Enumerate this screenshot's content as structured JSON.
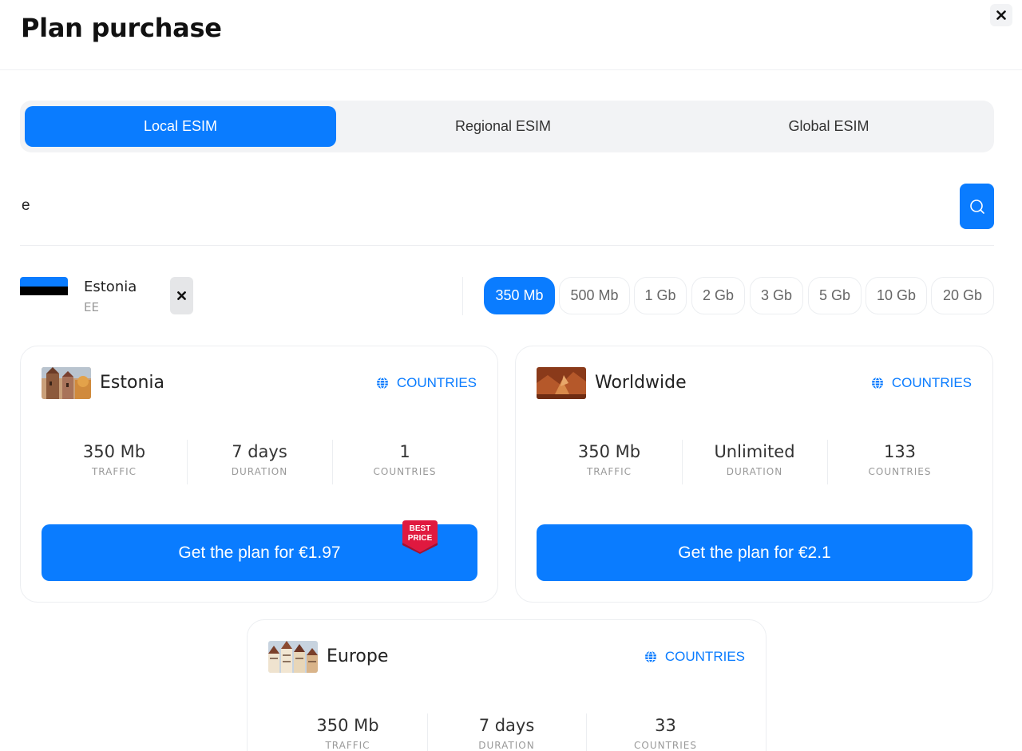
{
  "header": {
    "title": "Plan purchase",
    "close_icon": "close-icon"
  },
  "tabs": [
    {
      "label": "Local ESIM",
      "active": true
    },
    {
      "label": "Regional ESIM",
      "active": false
    },
    {
      "label": "Global ESIM",
      "active": false
    }
  ],
  "search": {
    "value": "e",
    "icon": "search-icon"
  },
  "selected_country": {
    "name": "Estonia",
    "code": "EE",
    "flag_colors": [
      "#0a7cff",
      "#000000",
      "#ffffff"
    ]
  },
  "sizes": [
    {
      "label": "350 Mb",
      "active": true
    },
    {
      "label": "500 Mb",
      "active": false
    },
    {
      "label": "1 Gb",
      "active": false
    },
    {
      "label": "2 Gb",
      "active": false
    },
    {
      "label": "3 Gb",
      "active": false
    },
    {
      "label": "5 Gb",
      "active": false
    },
    {
      "label": "10 Gb",
      "active": false
    },
    {
      "label": "20 Gb",
      "active": false
    }
  ],
  "plans": [
    {
      "name": "Estonia",
      "countries_link": "COUNTRIES",
      "traffic": "350 Mb",
      "traffic_label": "TRAFFIC",
      "duration": "7 days",
      "duration_label": "DURATION",
      "countries": "1",
      "countries_label": "COUNTRIES",
      "button": "Get the plan for €1.97",
      "badge_line1": "BEST",
      "badge_line2": "PRICE"
    },
    {
      "name": "Worldwide",
      "countries_link": "COUNTRIES",
      "traffic": "350 Mb",
      "traffic_label": "TRAFFIC",
      "duration": "Unlimited",
      "duration_label": "DURATION",
      "countries": "133",
      "countries_label": "COUNTRIES",
      "button": "Get the plan for €2.1"
    },
    {
      "name": "Europe",
      "countries_link": "COUNTRIES",
      "traffic": "350 Mb",
      "traffic_label": "TRAFFIC",
      "duration": "7 days",
      "duration_label": "DURATION",
      "countries": "33",
      "countries_label": "COUNTRIES"
    }
  ],
  "colors": {
    "accent": "#0a7cff",
    "badge": "#e0193f"
  }
}
